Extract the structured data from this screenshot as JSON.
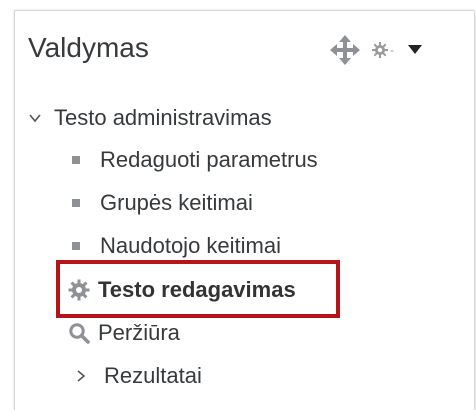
{
  "block": {
    "title": "Valdymas",
    "controls": {
      "move_icon": "move-icon",
      "gear_icon": "gear-icon",
      "dash": "-",
      "caret_icon": "caret-down-icon"
    }
  },
  "tree": {
    "section": {
      "label": "Testo administravimas",
      "icon": "chevron-down-icon",
      "expanded": true
    },
    "items": [
      {
        "label": "Redaguoti parametrus",
        "icon": "bullet"
      },
      {
        "label": "Grupės keitimai",
        "icon": "bullet"
      },
      {
        "label": "Naudotojo keitimai",
        "icon": "bullet"
      },
      {
        "label": "Testo redagavimas",
        "icon": "gear-icon",
        "highlighted": true
      },
      {
        "label": "Peržiūra",
        "icon": "magnifier-icon"
      },
      {
        "label": "Rezultatai",
        "icon": "chevron-right-icon",
        "expanded": false
      }
    ]
  },
  "colors": {
    "text": "#373a3c",
    "icon_gray": "#8e9196",
    "highlight_border": "#b71418"
  }
}
